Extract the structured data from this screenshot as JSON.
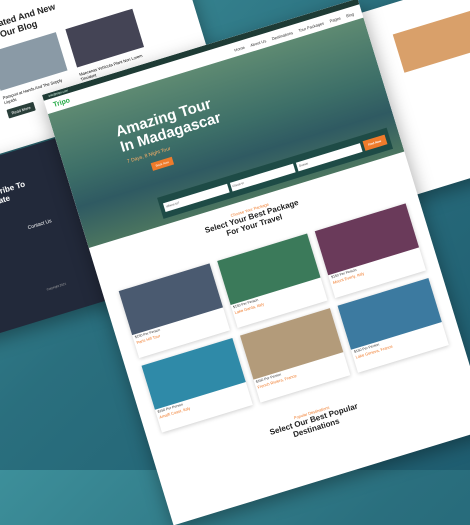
{
  "blog": {
    "title_line1": "Updated And New",
    "title_line2": "ost Our Blog",
    "post1": "Passport at Hands And The Supply Liquids",
    "post2": "Maecenas Vehicula Plant Non Lorem Tincidunt",
    "btn": "Read More"
  },
  "footer": {
    "subscribe": "Subscribe To",
    "subscribe2": "For Late",
    "contact": "Contact Us",
    "copyright": "Copyright 2021"
  },
  "main": {
    "topbar": "info@tripo.com",
    "logo": "Tripo",
    "nav": [
      "Home",
      "About Us",
      "Destinations",
      "Tour Packages",
      "Pages",
      "Blog"
    ],
    "hero_title_1": "Amazing Tour",
    "hero_title_2": "In Madagascar",
    "hero_sub": "7 Days, 8 Night Tour",
    "hero_btn": "Book Now",
    "search": [
      "Where to?",
      "Check-in",
      "Guests"
    ],
    "search_btn": "Find Now",
    "section_tag": "Choose Your Package",
    "section_title_1": "Select Your Best Package",
    "section_title_2": "For Your Travel",
    "packages": [
      {
        "price": "$150 Per Person",
        "name": "Paris Hill Tour",
        "color": "#4a5a70"
      },
      {
        "price": "$150 Per Person",
        "name": "Lake Garda, Italy",
        "color": "#3b7a5a"
      },
      {
        "price": "$150 Per Person",
        "name": "Mount Everly, Italy",
        "color": "#6a3a5a"
      },
      {
        "price": "$150 Per Person",
        "name": "Amalfi Coast, Italy",
        "color": "#2f8aa8"
      },
      {
        "price": "$150 Per Person",
        "name": "French Riviera, France",
        "color": "#b39b7a"
      },
      {
        "price": "$150 Per Person",
        "name": "Lake Geneva, France",
        "color": "#3c7aa0"
      }
    ],
    "popular_tag": "Popular Destinations",
    "popular_1": "Select Our Best Popular",
    "popular_2": "Destinations"
  }
}
